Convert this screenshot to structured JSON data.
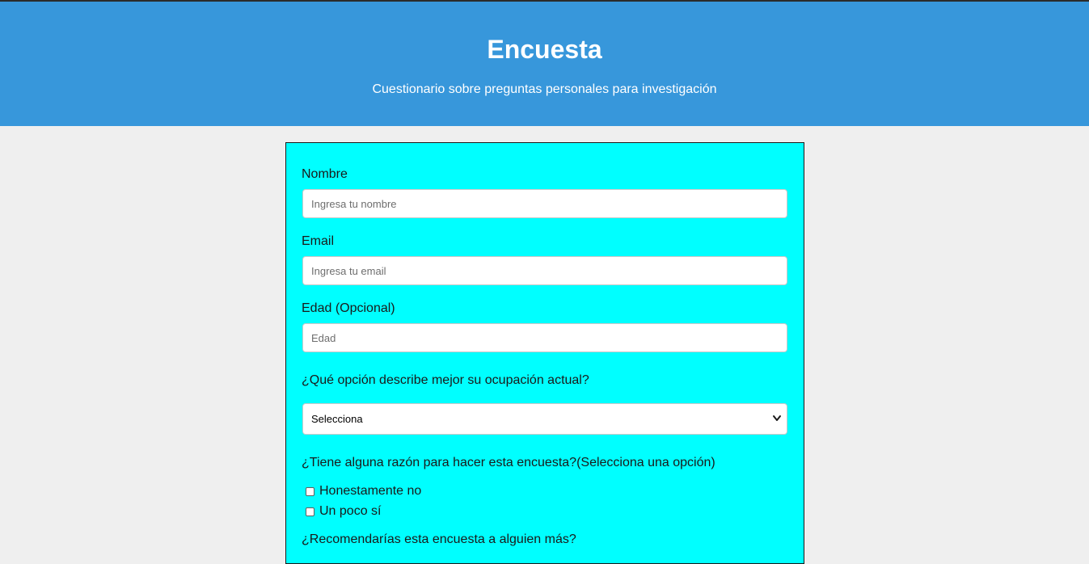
{
  "header": {
    "title": "Encuesta",
    "subtitle": "Cuestionario sobre preguntas personales para investigación"
  },
  "form": {
    "name": {
      "label": "Nombre",
      "placeholder": "Ingresa tu nombre",
      "value": ""
    },
    "email": {
      "label": "Email",
      "placeholder": "Ingresa tu email",
      "value": ""
    },
    "age": {
      "label": "Edad (Opcional)",
      "placeholder": "Edad",
      "value": ""
    },
    "occupation": {
      "label": "¿Qué opción describe mejor su ocupación actual?",
      "selected": "Selecciona",
      "icon": "chevron-down-icon"
    },
    "reason": {
      "label": "¿Tiene alguna razón para hacer esta encuesta?(Selecciona una opción)",
      "options": [
        {
          "label": "Honestamente no",
          "checked": false
        },
        {
          "label": "Un poco sí",
          "checked": false
        }
      ]
    },
    "recommend": {
      "label": "¿Recomendarías esta encuesta a alguien más?"
    }
  },
  "colors": {
    "header_bg": "#3797db",
    "card_bg": "#00ffff",
    "page_bg": "#efefef"
  }
}
